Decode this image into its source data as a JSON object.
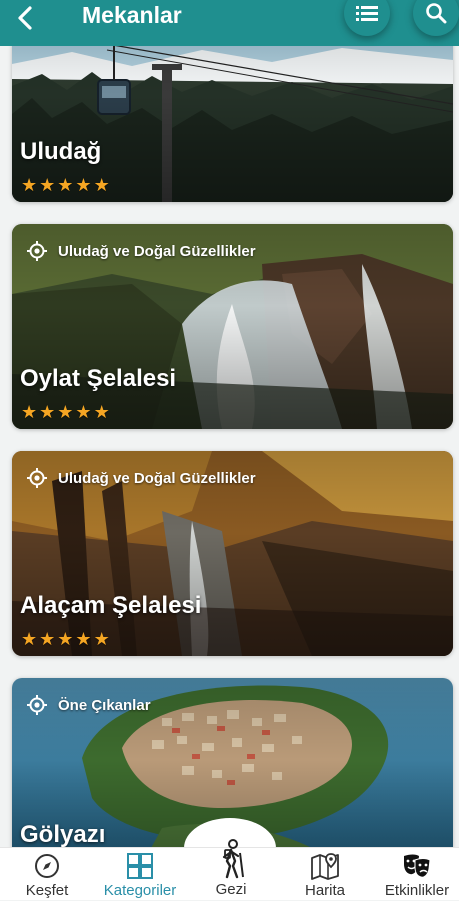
{
  "header": {
    "title": "Mekanlar",
    "back_icon": "back-arrow-icon",
    "list_icon": "list-icon",
    "search_icon": "search-icon",
    "color": "#1f8f8f"
  },
  "cards": [
    {
      "category": "",
      "name": "Uludağ",
      "rating": 5
    },
    {
      "category": "Uludağ ve Doğal Güzellikler",
      "name": "Oylat Şelalesi",
      "rating": 5
    },
    {
      "category": "Uludağ ve Doğal Güzellikler",
      "name": "Alaçam Şelalesi",
      "rating": 5
    },
    {
      "category": "Öne Çıkanlar",
      "name": "Gölyazı",
      "rating": null
    }
  ],
  "nav": {
    "active_color": "#2a8fa8",
    "items": [
      {
        "label": "Keşfet",
        "icon": "compass-icon"
      },
      {
        "label": "Kategoriler",
        "icon": "grid-icon"
      },
      {
        "label": "Gezi",
        "icon": "hiker-icon"
      },
      {
        "label": "Harita",
        "icon": "map-icon"
      },
      {
        "label": "Etkinlikler",
        "icon": "theater-masks-icon"
      }
    ]
  }
}
